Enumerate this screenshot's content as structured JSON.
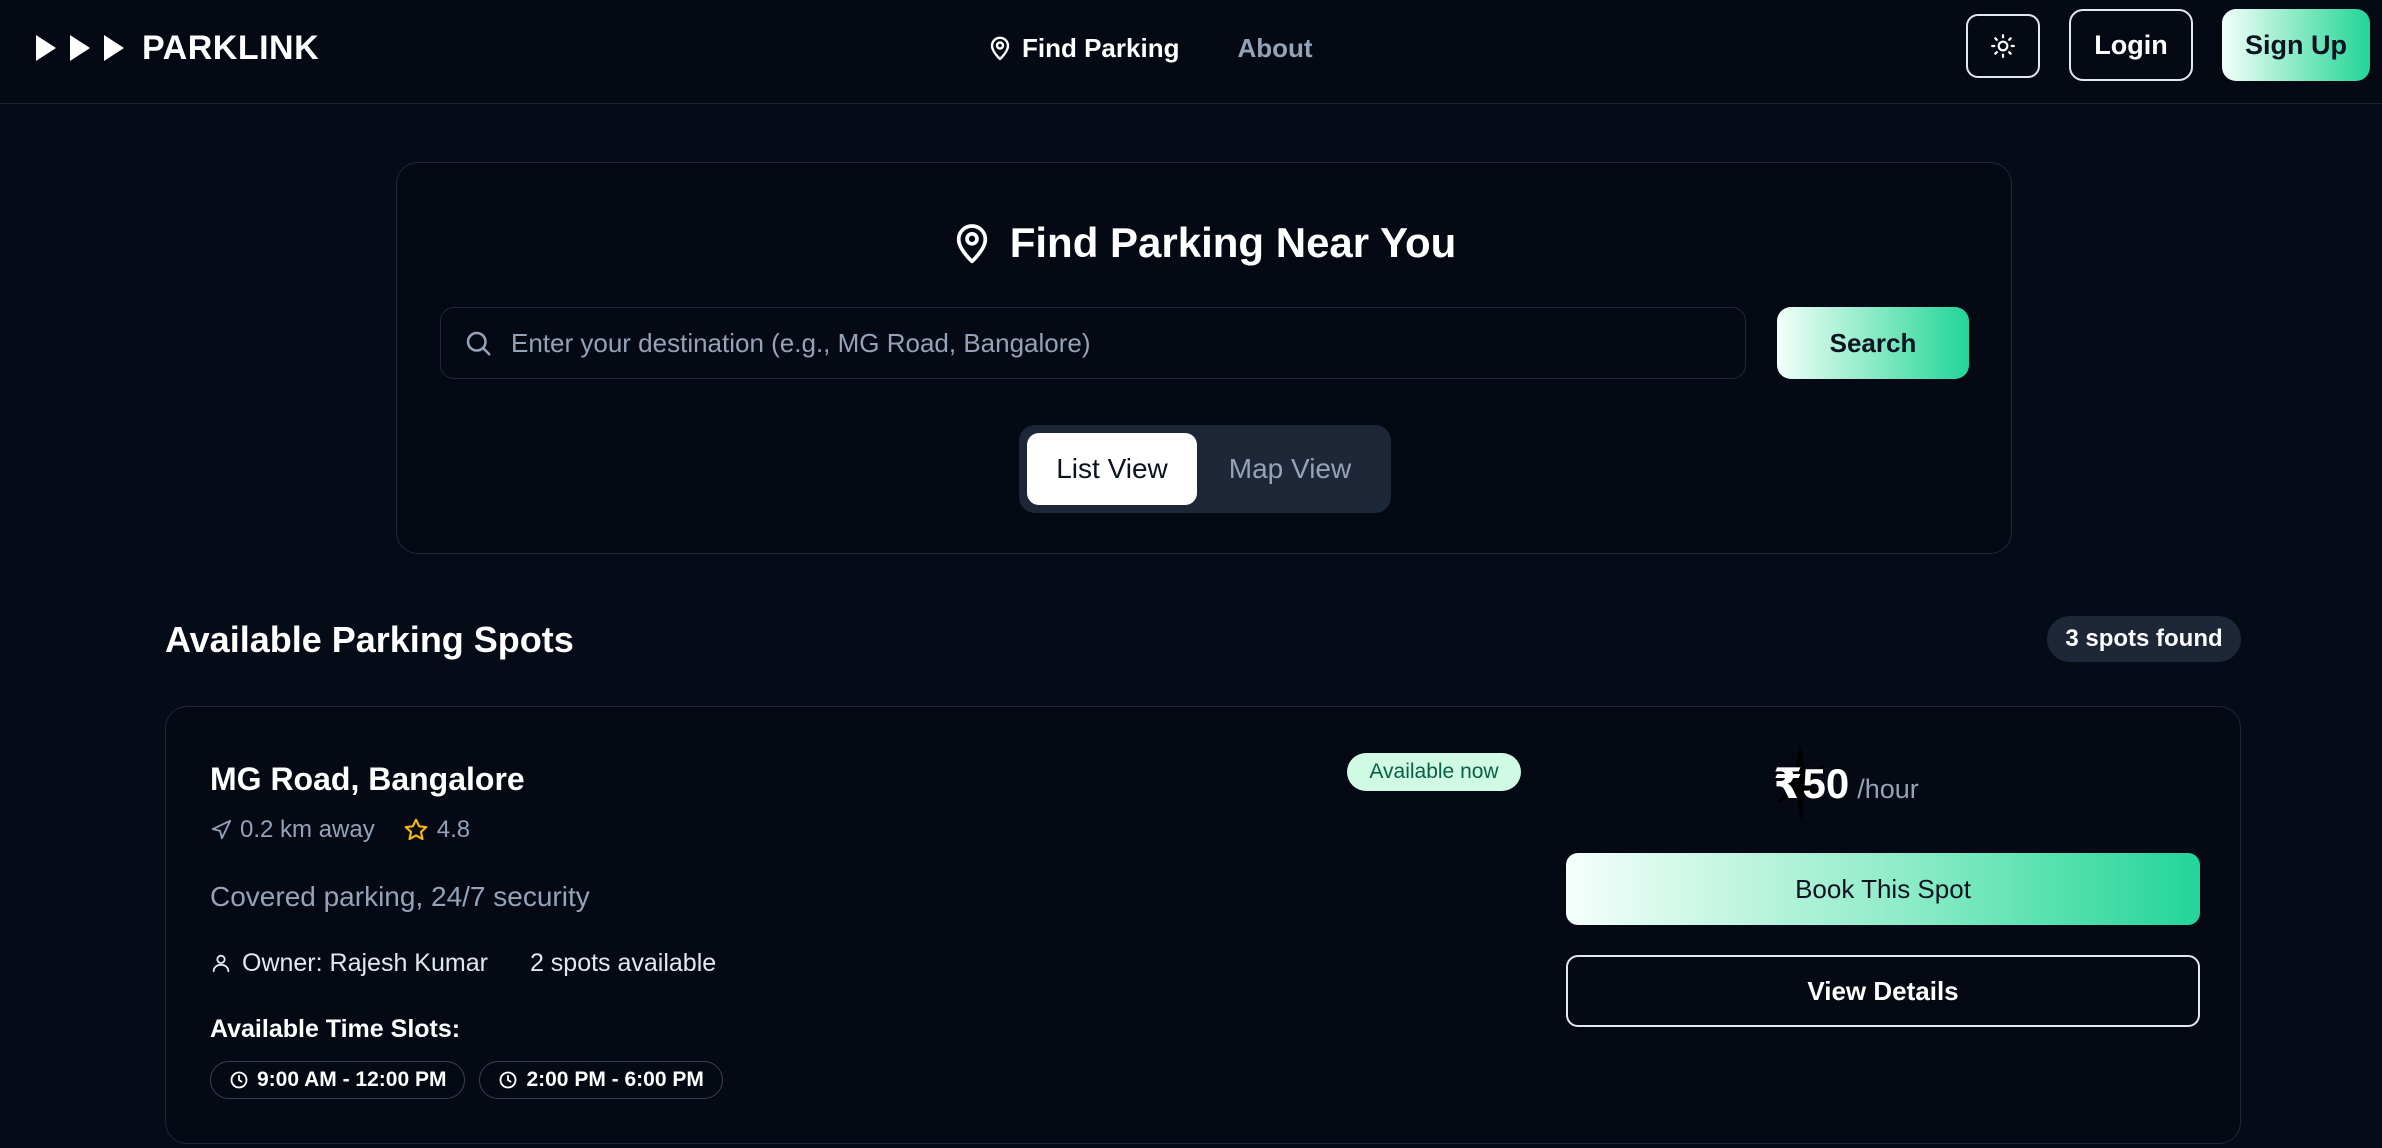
{
  "header": {
    "brand": "PARKLINK",
    "nav": {
      "find_parking": "Find Parking",
      "about": "About"
    },
    "theme_icon": "sun-icon",
    "login_label": "Login",
    "signup_label": "Sign Up"
  },
  "search": {
    "title": "Find Parking Near You",
    "placeholder": "Enter your destination (e.g., MG Road, Bangalore)",
    "value": "",
    "button_label": "Search",
    "views": {
      "list": "List View",
      "map": "Map View",
      "selected": "List View"
    }
  },
  "results": {
    "title": "Available Parking Spots",
    "count_label": "3 spots found"
  },
  "spots": [
    {
      "name": "MG Road, Bangalore",
      "distance": "0.2 km away",
      "rating": "4.8",
      "badge": "Available now",
      "description": "Covered parking, 24/7 security",
      "owner": "Owner: Rajesh Kumar",
      "spots_available": "2 spots available",
      "slots_title": "Available Time Slots:",
      "slots": [
        "9:00 AM - 12:00 PM",
        "2:00 PM - 6:00 PM"
      ],
      "price": "₹50",
      "price_unit": "/hour",
      "book_label": "Book This Spot",
      "details_label": "View Details"
    }
  ],
  "colors": {
    "background": "#060b18",
    "accent_green": "#22d598",
    "muted_text": "#94a3b8",
    "badge_bg": "#d1fae5",
    "rating_star": "#f5b50a"
  }
}
